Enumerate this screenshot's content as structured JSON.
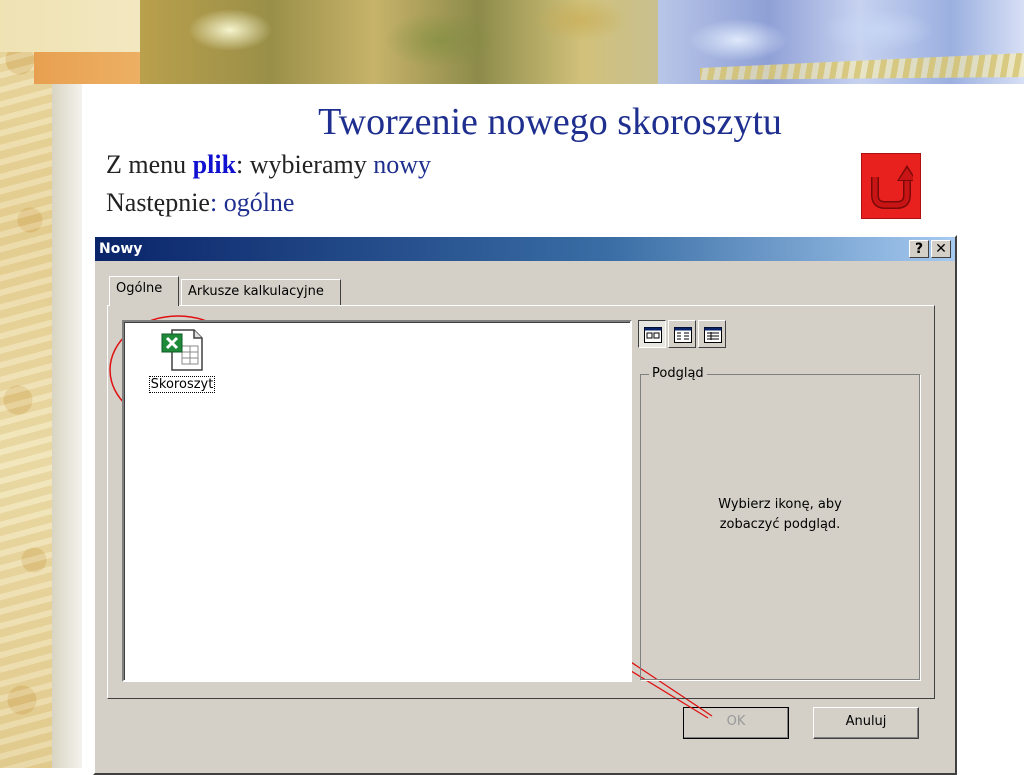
{
  "slide": {
    "title": "Tworzenie nowego skoroszytu",
    "line1": {
      "prefix": "Z menu ",
      "menu": "plik",
      "middle": ": wybieramy ",
      "item": "nowy"
    },
    "line2": {
      "prefix": "Następnie",
      "colon": ": ",
      "item": "ogólne"
    }
  },
  "return_button": {
    "icon": "u-turn-arrow-icon",
    "color": "#e8201e"
  },
  "dialog": {
    "title": "Nowy",
    "help_label": "?",
    "close_label": "✕",
    "tabs": [
      {
        "label": "Ogólne",
        "active": true
      },
      {
        "label": "Arkusze kalkulacyjne",
        "active": false
      }
    ],
    "files": [
      {
        "label": "Skoroszyt",
        "icon": "excel-workbook-icon"
      }
    ],
    "view_buttons": [
      {
        "name": "large-icons-view-icon",
        "pressed": true
      },
      {
        "name": "list-view-icon",
        "pressed": false
      },
      {
        "name": "details-view-icon",
        "pressed": false
      }
    ],
    "preview": {
      "label": "Podgląd",
      "message_line1": "Wybierz ikonę, aby",
      "message_line2": "zobaczyć podgląd."
    },
    "ok_label": "OK",
    "cancel_label": "Anuluj"
  },
  "colors": {
    "title_blue": "#1f2f8f",
    "keyword_blue": "#1010d0",
    "annotation_red": "#e01010",
    "dialog_gray": "#d4d0c8"
  }
}
